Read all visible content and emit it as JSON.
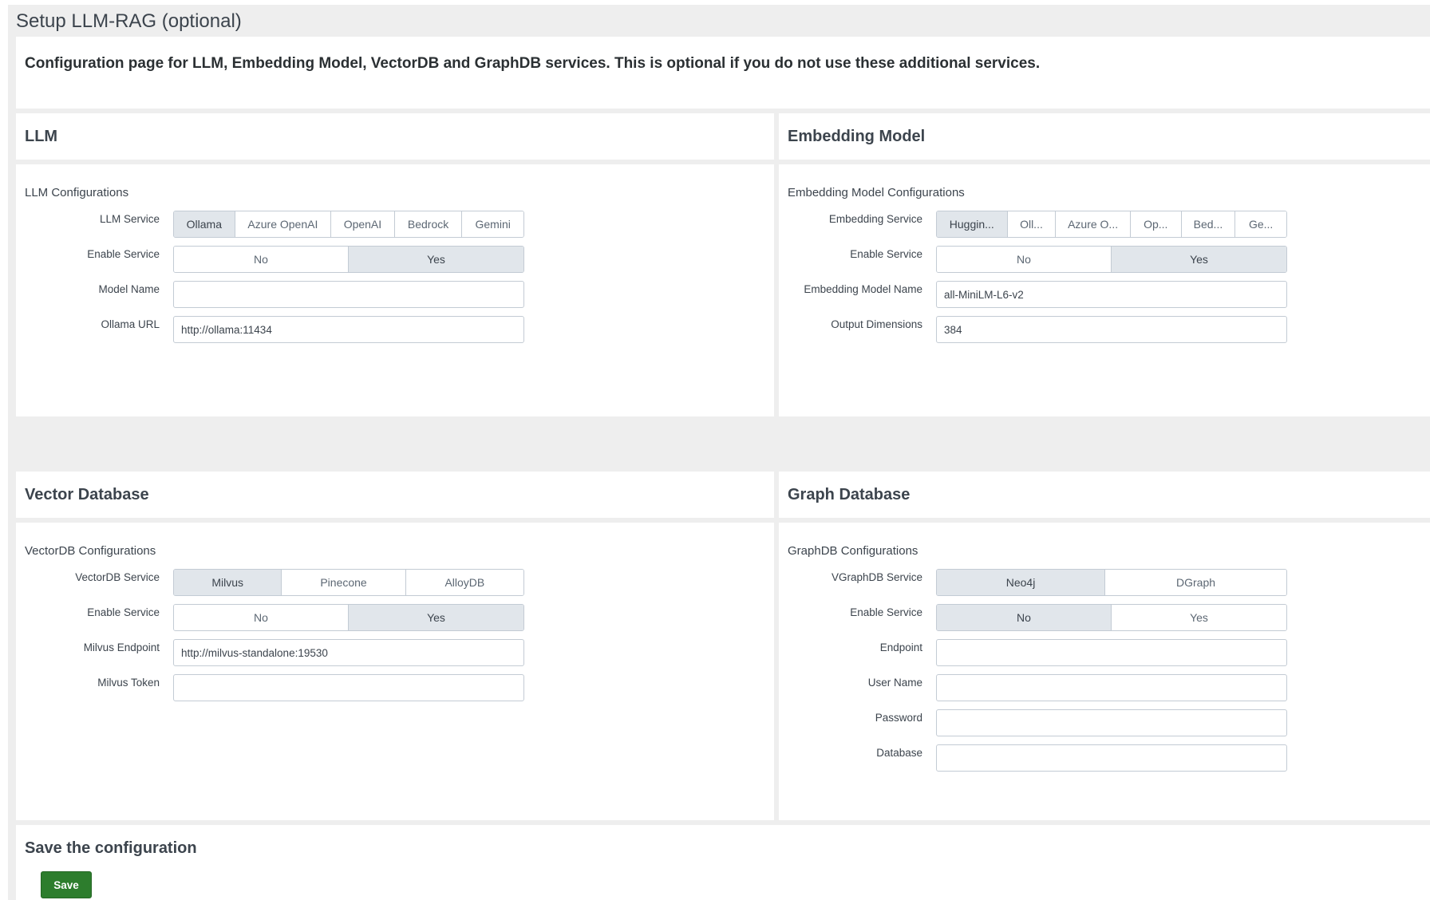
{
  "page": {
    "title": "Setup LLM-RAG (optional)",
    "description": "Configuration page for LLM, Embedding Model, VectorDB and GraphDB services. This is optional if you do not use these additional services."
  },
  "llm": {
    "title": "LLM",
    "subtitle": "LLM Configurations",
    "service_label": "LLM Service",
    "services": [
      "Ollama",
      "Azure OpenAI",
      "OpenAI",
      "Bedrock",
      "Gemini"
    ],
    "selected_service": "Ollama",
    "enable_label": "Enable Service",
    "enable_options": [
      "No",
      "Yes"
    ],
    "enable_selected": "Yes",
    "model_name_label": "Model Name",
    "model_name_value": "",
    "url_label": "Ollama URL",
    "url_value": "http://ollama:11434"
  },
  "embedding": {
    "title": "Embedding Model",
    "subtitle": "Embedding Model Configurations",
    "service_label": "Embedding Service",
    "services": [
      "Huggin...",
      "Oll...",
      "Azure O...",
      "Op...",
      "Bed...",
      "Ge..."
    ],
    "selected_service": "Huggin...",
    "enable_label": "Enable Service",
    "enable_options": [
      "No",
      "Yes"
    ],
    "enable_selected": "Yes",
    "model_name_label": "Embedding Model Name",
    "model_name_value": "all-MiniLM-L6-v2",
    "dims_label": "Output Dimensions",
    "dims_value": "384"
  },
  "vectordb": {
    "title": "Vector Database",
    "subtitle": "VectorDB Configurations",
    "service_label": "VectorDB Service",
    "services": [
      "Milvus",
      "Pinecone",
      "AlloyDB"
    ],
    "selected_service": "Milvus",
    "enable_label": "Enable Service",
    "enable_options": [
      "No",
      "Yes"
    ],
    "enable_selected": "Yes",
    "endpoint_label": "Milvus Endpoint",
    "endpoint_value": "http://milvus-standalone:19530",
    "token_label": "Milvus Token",
    "token_value": ""
  },
  "graphdb": {
    "title": "Graph Database",
    "subtitle": "GraphDB Configurations",
    "service_label": "VGraphDB Service",
    "services": [
      "Neo4j",
      "DGraph"
    ],
    "selected_service": "Neo4j",
    "enable_label": "Enable Service",
    "enable_options": [
      "No",
      "Yes"
    ],
    "enable_selected": "No",
    "endpoint_label": "Endpoint",
    "endpoint_value": "",
    "username_label": "User Name",
    "username_value": "",
    "password_label": "Password",
    "password_value": "",
    "database_label": "Database",
    "database_value": ""
  },
  "save": {
    "title": "Save the configuration",
    "button_label": "Save",
    "button_color": "#2d7d2d"
  }
}
